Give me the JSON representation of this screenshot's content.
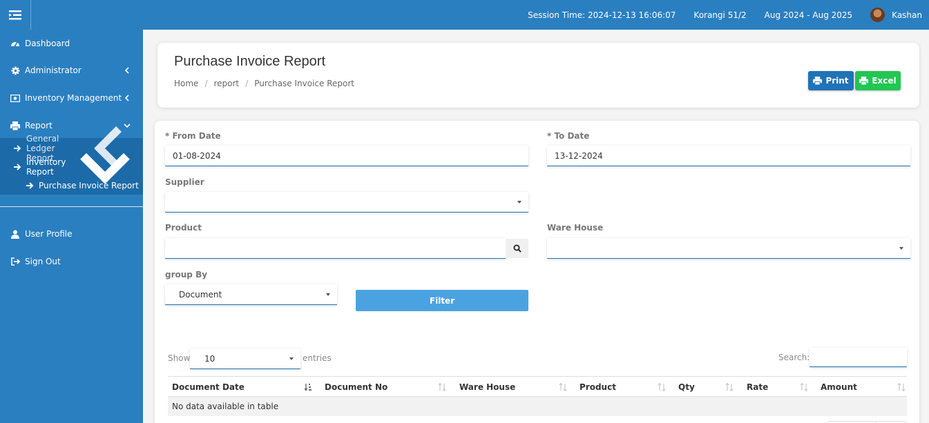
{
  "topbar": {
    "session_time": "Session Time: 2024-12-13 16:06:07",
    "branch": "Korangi 51/2",
    "fiscal_period": "Aug 2024 - Aug 2025",
    "username": "Kashan"
  },
  "sidebar": {
    "dashboard": "Dashboard",
    "administrator": "Administrator",
    "inventory_management": "Inventory Management",
    "report": "Report",
    "general_ledger_report": "General Ledger Report",
    "inventory_report": "Inventory Report",
    "purchase_invoice_report": "Purchase Invoice Report",
    "user_profile": "User Profile",
    "sign_out": "Sign Out"
  },
  "header": {
    "title": "Purchase Invoice Report",
    "breadcrumb": [
      "Home",
      "report",
      "Purchase Invoice Report"
    ],
    "print_label": "Print",
    "excel_label": "Excel"
  },
  "form": {
    "from_date_label": "* From Date",
    "from_date_value": "01-08-2024",
    "to_date_label": "* To Date",
    "to_date_value": "13-12-2024",
    "supplier_label": "Supplier",
    "supplier_value": "",
    "product_label": "Product",
    "product_value": "",
    "warehouse_label": "Ware House",
    "warehouse_value": "",
    "group_by_label": "group By",
    "group_by_value": "Document",
    "filter_label": "Filter"
  },
  "table": {
    "show_label": "Show",
    "page_size": "10",
    "entries_label": "entries",
    "search_label": "Search:",
    "columns": [
      "Document Date",
      "Document No",
      "Ware House",
      "Product",
      "Qty",
      "Rate",
      "Amount"
    ],
    "empty_message": "No data available in table"
  },
  "colors": {
    "primary": "#2a7fc0",
    "submenu": "#1c6aa8",
    "print_button": "#1f73b7",
    "excel_button": "#22c653",
    "filter_button": "#4aa3e0"
  }
}
